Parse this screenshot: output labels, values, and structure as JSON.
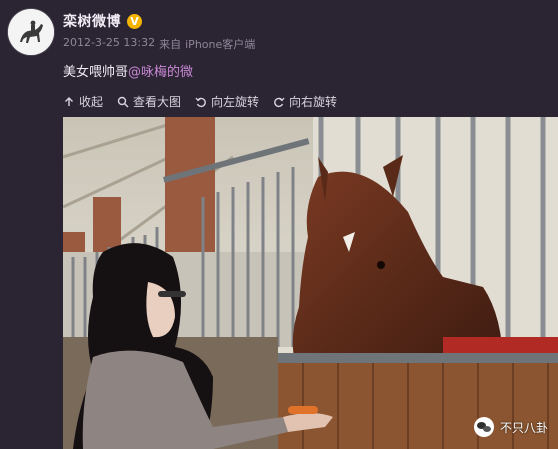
{
  "post": {
    "username": "栾树微博",
    "verified_mark": "V",
    "timestamp": "2012-3-25 13:32",
    "source_prefix": "来自",
    "source_name": "iPhone客户端",
    "text_prefix": "美女喂帅哥",
    "mention": "@咏梅的微"
  },
  "actions": {
    "collapse": "收起",
    "view_large": "查看大图",
    "rotate_left": "向左旋转",
    "rotate_right": "向右旋转"
  },
  "watermark": {
    "text": "不只八卦"
  },
  "colors": {
    "background": "#2b2433",
    "mention": "#c98ad6",
    "verified": "#f5b400"
  }
}
